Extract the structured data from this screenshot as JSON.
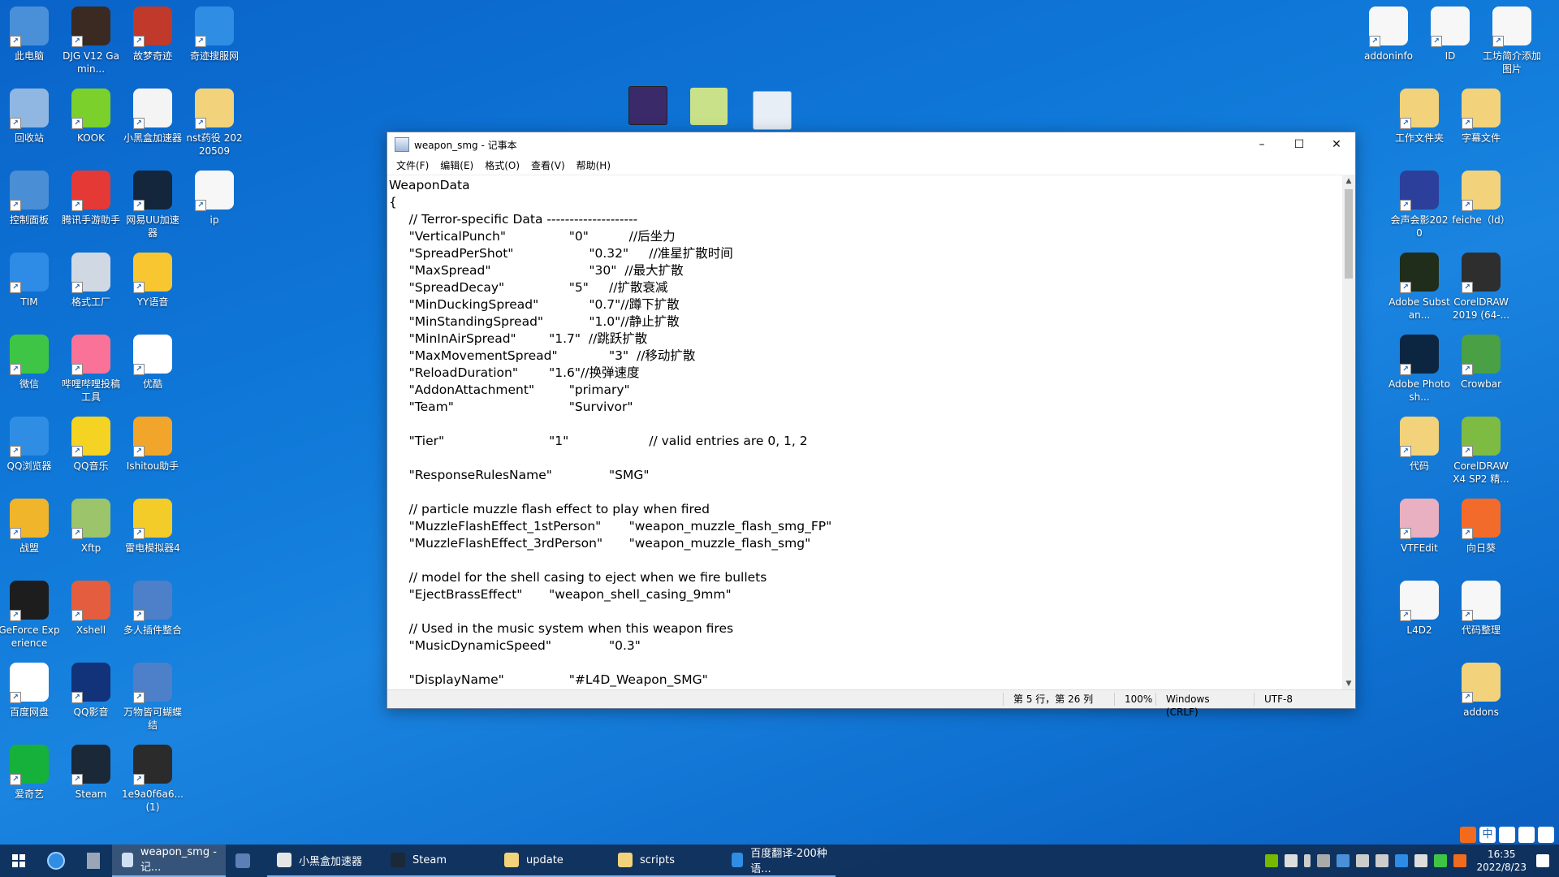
{
  "desktop": {
    "left_icons": [
      {
        "label": "此电脑",
        "icon": "computer-icon",
        "color": "#4a90d9"
      },
      {
        "label": "DJG V12 Gamin...",
        "icon": "avatar-icon",
        "color": "#3a2a22"
      },
      {
        "label": "故梦奇迹",
        "icon": "game-icon",
        "color": "#c0392b"
      },
      {
        "label": "奇迹搜服网",
        "icon": "browser-icon",
        "color": "#2f8de4"
      },
      {
        "label": "回收站",
        "icon": "recycle-bin-icon",
        "color": "#8fb7e2"
      },
      {
        "label": "KOOK",
        "icon": "kook-icon",
        "color": "#7bd02c"
      },
      {
        "label": "小黑盒加速器",
        "icon": "lightning-icon",
        "color": "#f4f4f4"
      },
      {
        "label": "nst药役 20220509",
        "icon": "folder-icon",
        "color": "#f2d27a"
      },
      {
        "label": "控制面板",
        "icon": "control-panel-icon",
        "color": "#4a8ed6"
      },
      {
        "label": "腾讯手游助手",
        "icon": "game-assistant-icon",
        "color": "#e53935"
      },
      {
        "label": "网易UU加速器",
        "icon": "uu-icon",
        "color": "#13263b"
      },
      {
        "label": "ip",
        "icon": "text-file-icon",
        "color": "#f7f7f7"
      },
      {
        "label": "TIM",
        "icon": "tim-icon",
        "color": "#2e8be6"
      },
      {
        "label": "格式工厂",
        "icon": "factory-icon",
        "color": "#d0d8e4"
      },
      {
        "label": "YY语音",
        "icon": "yy-icon",
        "color": "#f7c631"
      },
      {
        "label": "",
        "icon": "",
        "color": ""
      },
      {
        "label": "微信",
        "icon": "wechat-icon",
        "color": "#3ec545"
      },
      {
        "label": "哔哩哔哩投稿工具",
        "icon": "bilibili-icon",
        "color": "#fb7299"
      },
      {
        "label": "优酷",
        "icon": "youku-icon",
        "color": "#ffffff"
      },
      {
        "label": "",
        "icon": "",
        "color": ""
      },
      {
        "label": "QQ浏览器",
        "icon": "qq-browser-icon",
        "color": "#2f8de4"
      },
      {
        "label": "QQ音乐",
        "icon": "qq-music-icon",
        "color": "#f5d322"
      },
      {
        "label": "Ishitou助手",
        "icon": "ishitou-icon",
        "color": "#f1a62b"
      },
      {
        "label": "",
        "icon": "",
        "color": ""
      },
      {
        "label": "战盟",
        "icon": "zhanmeng-icon",
        "color": "#f0b52a"
      },
      {
        "label": "Xftp",
        "icon": "xftp-icon",
        "color": "#9cc46a"
      },
      {
        "label": "雷电模拟器4",
        "icon": "ldplayer-icon",
        "color": "#f3cc2a"
      },
      {
        "label": "",
        "icon": "",
        "color": ""
      },
      {
        "label": "GeForce Experience",
        "icon": "nvidia-icon",
        "color": "#1d1d1d"
      },
      {
        "label": "Xshell",
        "icon": "xshell-icon",
        "color": "#e35d3e"
      },
      {
        "label": "多人插件整合",
        "icon": "winrar-icon",
        "color": "#4e7fc9"
      },
      {
        "label": "",
        "icon": "",
        "color": ""
      },
      {
        "label": "百度网盘",
        "icon": "baidu-netdisk-icon",
        "color": "#ffffff"
      },
      {
        "label": "QQ影音",
        "icon": "qq-player-icon",
        "color": "#12327a"
      },
      {
        "label": "万物皆可蝴蝶结",
        "icon": "winrar-icon",
        "color": "#4e7fc9"
      },
      {
        "label": "",
        "icon": "",
        "color": ""
      },
      {
        "label": "爱奇艺",
        "icon": "iqiyi-icon",
        "color": "#16b13b"
      },
      {
        "label": "Steam",
        "icon": "steam-icon",
        "color": "#1b2838"
      },
      {
        "label": "1e9a0f6a6... (1)",
        "icon": "image-file-icon",
        "color": "#2b2b2b"
      }
    ],
    "right_icons": [
      {
        "label": "addoninfo",
        "icon": "text-file-icon",
        "color": "#f7f7f7"
      },
      {
        "label": "ID",
        "icon": "text-file-icon",
        "color": "#f7f7f7"
      },
      {
        "label": "工坊简介添加图片",
        "icon": "text-file-icon",
        "color": "#f7f7f7"
      },
      {
        "label": "工作文件夹",
        "icon": "folder-icon",
        "color": "#f2d27a"
      },
      {
        "label": "字幕文件",
        "icon": "folder-icon",
        "color": "#f2d27a"
      },
      {
        "label": "会声会影2020",
        "icon": "vegas-icon",
        "color": "#2c3f9a"
      },
      {
        "label": "feiche（ld）",
        "icon": "folder-icon",
        "color": "#f2d27a"
      },
      {
        "label": "Adobe Substan...",
        "icon": "substance-icon",
        "color": "#1f2d1a"
      },
      {
        "label": "CorelDRAW 2019 (64-...",
        "icon": "coreldraw-icon",
        "color": "#2e2e2e"
      },
      {
        "label": "Adobe Photosh...",
        "icon": "photoshop-icon",
        "color": "#0c2540"
      },
      {
        "label": "Crowbar",
        "icon": "crowbar-icon",
        "color": "#4aa045"
      },
      {
        "label": "代码",
        "icon": "folder-icon",
        "color": "#f2d27a"
      },
      {
        "label": "CorelDRAW X4 SP2 精...",
        "icon": "coreldraw-icon",
        "color": "#7dbb43"
      },
      {
        "label": "VTFEdit",
        "icon": "vtfedit-icon",
        "color": "#e8b0c0"
      },
      {
        "label": "向日葵",
        "icon": "sunflower-icon",
        "color": "#f26b2a"
      },
      {
        "label": "L4D2",
        "icon": "audio-file-icon",
        "color": "#f7f7f7"
      },
      {
        "label": "代码整理",
        "icon": "text-file-icon",
        "color": "#f7f7f7"
      },
      {
        "label": "addons",
        "icon": "folder-icon",
        "color": "#f2d27a"
      }
    ]
  },
  "notepad": {
    "title": "weapon_smg - 记事本",
    "menu": [
      "文件(F)",
      "编辑(E)",
      "格式(O)",
      "查看(V)",
      "帮助(H)"
    ],
    "lines": [
      "WeaponData",
      "{",
      "\t// Terror-specific Data --------------------",
      "\t\"VerticalPunch\"\t\t\t\t\"0\"\t\t//后坐力",
      "\t\"SpreadPerShot\"\t\t\t\t\"0.32\"\t//准星扩散时间",
      "\t\"MaxSpread\"\t\t\t\t\t\"30\"  //最大扩散",
      "\t\"SpreadDecay\"\t\t\t\t\"5\"\t//扩散衰减",
      "\t\"MinDuckingSpread\"\t\t\t\"0.7\"//蹲下扩散",
      "\t\"MinStandingSpread\"\t\t\t\"1.0\"//静止扩散",
      "\t\"MinInAirSpread\"\t\t\"1.7\"  //跳跃扩散",
      "\t\"MaxMovementSpread\"\t\t\t\"3\"  //移动扩散",
      "\t\"ReloadDuration\"\t\t\"1.6\"//换弹速度",
      "\t\"AddonAttachment\"\t\t\"primary\"",
      "\t\"Team\"\t\t\t\t\t\t\"Survivor\"",
      "",
      "\t\"Tier\"\t\t\t\t\t\t\"1\"\t\t\t\t// valid entries are 0, 1, 2",
      "",
      "\t\"ResponseRulesName\"\t\t\t\"SMG\"",
      "",
      "\t// particle muzzle flash effect to play when fired",
      "\t\"MuzzleFlashEffect_1stPerson\"\t\t\"weapon_muzzle_flash_smg_FP\"",
      "\t\"MuzzleFlashEffect_3rdPerson\"\t\t\"weapon_muzzle_flash_smg\"",
      "",
      "\t// model for the shell casing to eject when we fire bullets",
      "\t\"EjectBrassEffect\"\t\t\"weapon_shell_casing_9mm\"",
      "",
      "\t// Used in the music system when this weapon fires",
      "\t\"MusicDynamicSpeed\"\t\t\t\"0.3\"",
      "",
      "\t\"DisplayName\"\t\t\t\t\"#L4D_Weapon_SMG\""
    ],
    "status": {
      "position": "第 5 行，第 26 列",
      "zoom": "100%",
      "eol": "Windows (CRLF)",
      "encoding": "UTF-8"
    }
  },
  "taskbar": {
    "apps": [
      {
        "label": "weapon_smg - 记...",
        "icon": "notepad-icon",
        "color": "#cfe0f5",
        "active": true
      },
      {
        "label": "",
        "icon": "settings-app-icon",
        "color": "#5c7fb5",
        "active": false
      },
      {
        "label": "小黑盒加速器",
        "icon": "lightning-icon",
        "color": "#e6e6e6",
        "active": false
      },
      {
        "label": "Steam",
        "icon": "steam-icon",
        "color": "#1b2838",
        "active": false
      },
      {
        "label": "update",
        "icon": "folder-icon",
        "color": "#f2d27a",
        "active": false
      },
      {
        "label": "scripts",
        "icon": "folder-icon",
        "color": "#f2d27a",
        "active": false
      },
      {
        "label": "百度翻译-200种语...",
        "icon": "browser-icon",
        "color": "#2f8de4",
        "active": false
      }
    ],
    "time": "16:35",
    "date": "2022/8/23",
    "ime": "中"
  }
}
